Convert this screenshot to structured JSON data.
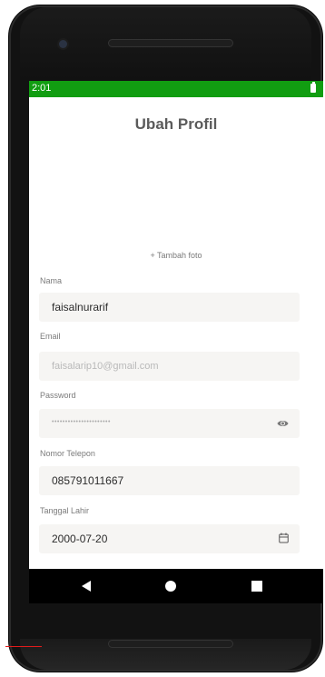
{
  "status_bar": {
    "time": "2:01",
    "color": "#119d11"
  },
  "profile": {
    "title": "Ubah Profil",
    "add_photo": "+ Tambah foto",
    "fields": [
      {
        "label": "Nama",
        "value": "faisalnurarif"
      },
      {
        "label": "Email",
        "value": "faisalarip10@gmail.com",
        "disabled": true
      },
      {
        "label": "Password",
        "value": "••••••••••••••••••••••",
        "icon": "eye-icon"
      },
      {
        "label": "Nomor Telepon",
        "value": "085791011667"
      },
      {
        "label": "Tanggal Lahir",
        "value": "2000-07-20",
        "icon": "calendar-icon"
      }
    ]
  },
  "nav_bar": {
    "back": "back-icon",
    "home": "home-icon",
    "recent": "recent-apps-icon"
  }
}
